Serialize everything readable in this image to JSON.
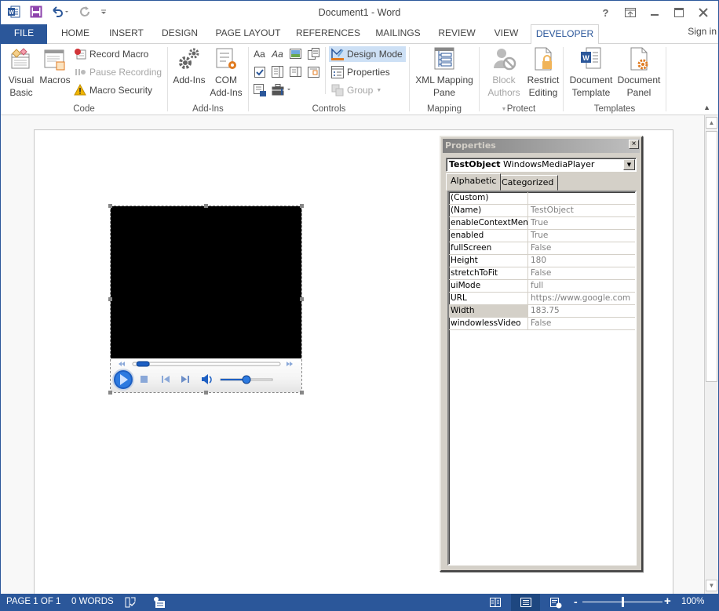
{
  "window": {
    "title": "Document1 - Word",
    "controls": {
      "help": "?",
      "ribbon_options": "ribbon-display-options",
      "minimize": "minimize",
      "maximize": "maximize",
      "close": "close"
    }
  },
  "quick_access": [
    "word-logo",
    "save",
    "undo",
    "redo",
    "customize"
  ],
  "tabs": [
    {
      "label": "FILE"
    },
    {
      "label": "HOME"
    },
    {
      "label": "INSERT"
    },
    {
      "label": "DESIGN"
    },
    {
      "label": "PAGE LAYOUT"
    },
    {
      "label": "REFERENCES"
    },
    {
      "label": "MAILINGS"
    },
    {
      "label": "REVIEW"
    },
    {
      "label": "VIEW"
    },
    {
      "label": "DEVELOPER",
      "active": true
    }
  ],
  "sign_in": "Sign in",
  "ribbon": {
    "code": {
      "label": "Code",
      "visual_basic": "Visual Basic",
      "visual_basic_l1": "Visual",
      "visual_basic_l2": "Basic",
      "macros": "Macros",
      "record_macro": "Record Macro",
      "pause_recording": "Pause Recording",
      "macro_security": "Macro Security"
    },
    "addins": {
      "label": "Add-Ins",
      "addins": "Add-Ins",
      "com_l1": "COM",
      "com_l2": "Add-Ins"
    },
    "controls": {
      "label": "Controls",
      "design_mode": "Design Mode",
      "properties": "Properties",
      "group": "Group",
      "rich_text": "Aa",
      "plain_text": "Aa"
    },
    "mapping": {
      "label": "Mapping",
      "xml_l1": "XML Mapping",
      "xml_l2": "Pane"
    },
    "protect": {
      "label": "Protect",
      "block_l1": "Block",
      "block_l2": "Authors",
      "restrict_l1": "Restrict",
      "restrict_l2": "Editing"
    },
    "templates": {
      "label": "Templates",
      "doc_template_l1": "Document",
      "doc_template_l2": "Template",
      "doc_panel_l1": "Document",
      "doc_panel_l2": "Panel"
    }
  },
  "media_player": {
    "seek_position": 0.03,
    "volume": 0.5
  },
  "properties_panel": {
    "title": "Properties",
    "object_name": "TestObject",
    "object_type": "WindowsMediaPlayer",
    "tabs": [
      "Alphabetic",
      "Categorized"
    ],
    "active_tab": "Alphabetic",
    "rows": [
      {
        "name": "(Custom)",
        "value": ""
      },
      {
        "name": "(Name)",
        "value": "TestObject"
      },
      {
        "name": "enableContextMenu",
        "value": "True"
      },
      {
        "name": "enabled",
        "value": "True"
      },
      {
        "name": "fullScreen",
        "value": "False"
      },
      {
        "name": "Height",
        "value": "180"
      },
      {
        "name": "stretchToFit",
        "value": "False"
      },
      {
        "name": "uiMode",
        "value": "full"
      },
      {
        "name": "URL",
        "value": "https://www.google.com"
      },
      {
        "name": "Width",
        "value": "183.75",
        "selected": true
      },
      {
        "name": "windowlessVideo",
        "value": "False"
      }
    ]
  },
  "status_bar": {
    "page": "PAGE 1 OF 1",
    "words": "0 WORDS",
    "zoom": "100%",
    "zoom_level": 1.0,
    "view_mode": "Print Layout"
  },
  "colors": {
    "accent": "#2b579a",
    "design_mode_highlight": "#cde0f5",
    "classic_face": "#d4d0c8"
  }
}
